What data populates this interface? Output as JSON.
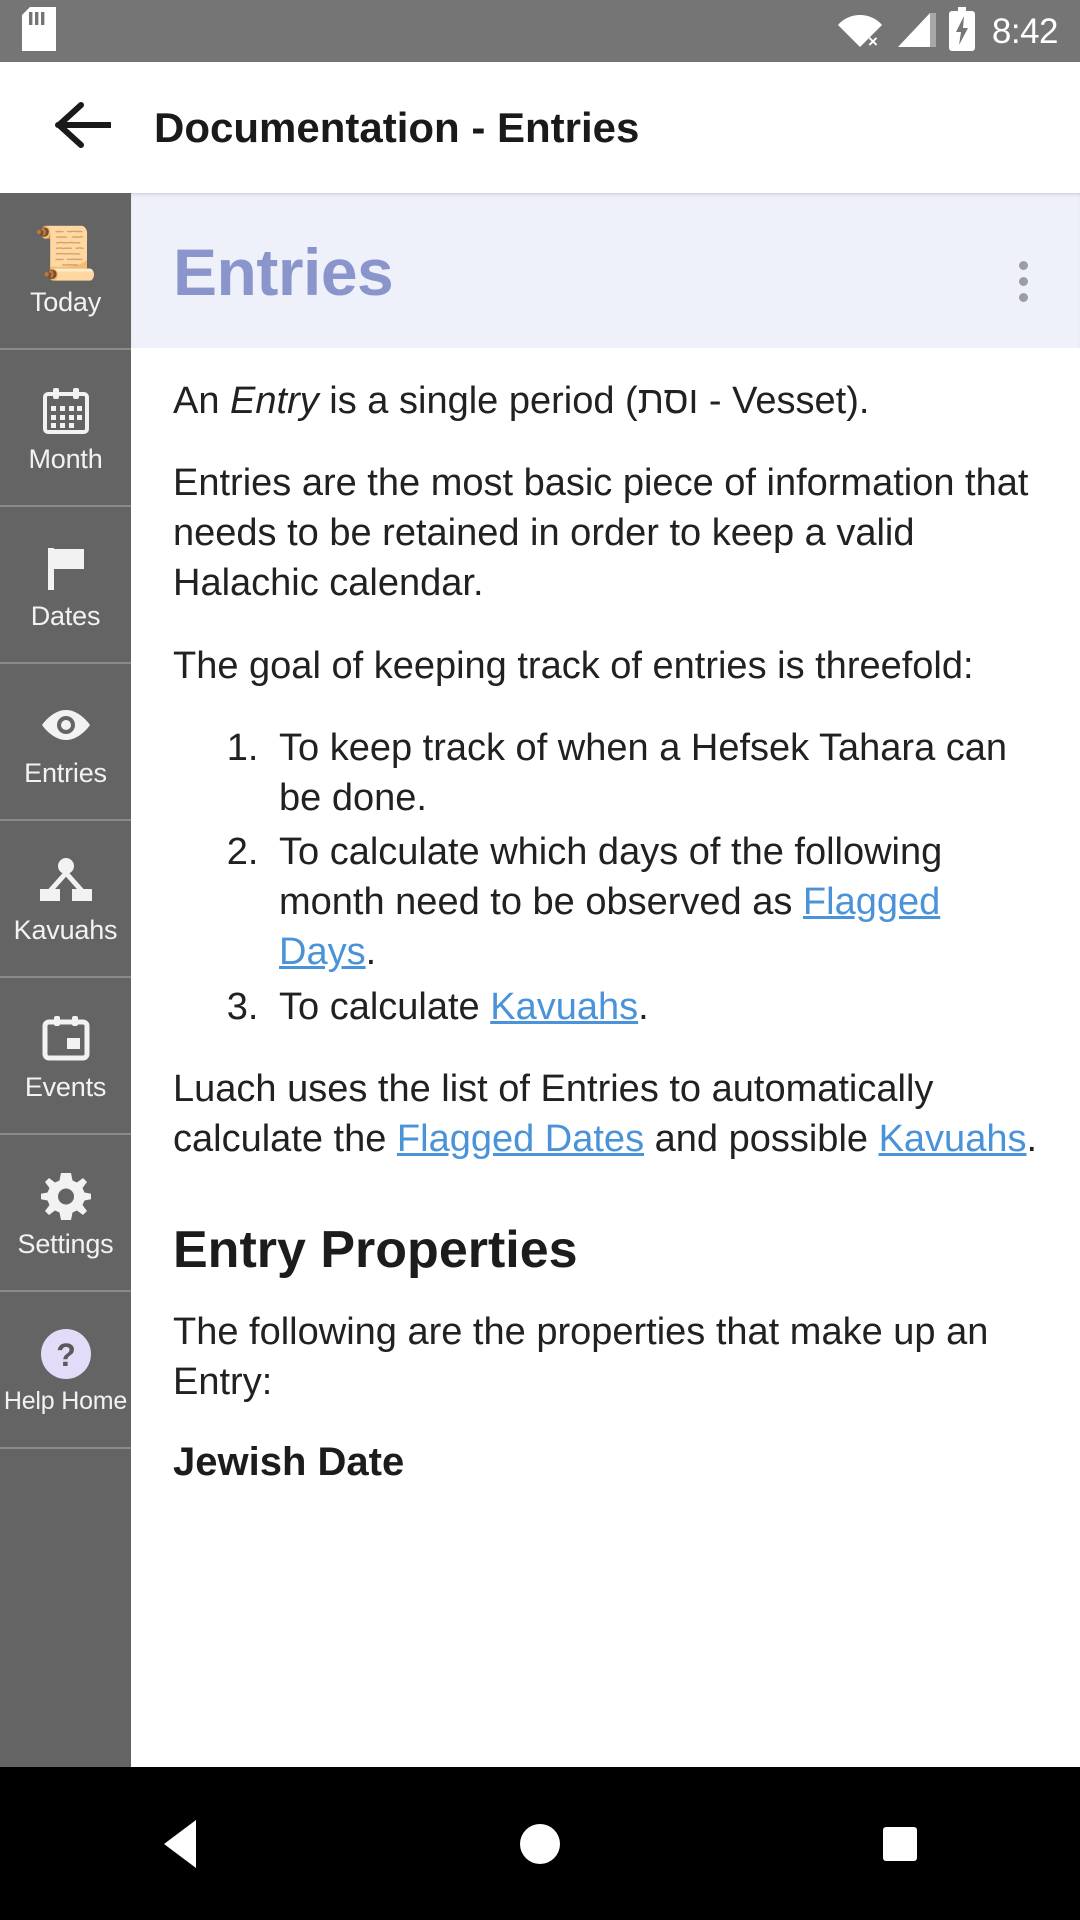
{
  "statusbar": {
    "time": "8:42",
    "icons": [
      "sd-card-icon",
      "wifi-no-internet-icon",
      "cell-signal-icon",
      "battery-charging-icon"
    ]
  },
  "actionbar": {
    "back_icon": "arrow-back-icon",
    "title": "Documentation -  Entries"
  },
  "sidebar": {
    "items": [
      {
        "label": "Today",
        "icon": "scroll-emoji-icon"
      },
      {
        "label": "Month",
        "icon": "calendar-month-icon"
      },
      {
        "label": "Dates",
        "icon": "flag-icon"
      },
      {
        "label": "Entries",
        "icon": "eye-icon"
      },
      {
        "label": "Kavuahs",
        "icon": "account-tree-icon"
      },
      {
        "label": "Events",
        "icon": "event-note-icon"
      },
      {
        "label": "Settings",
        "icon": "gear-icon"
      },
      {
        "label": "Help Home",
        "icon": "help-circle-icon"
      }
    ]
  },
  "doc": {
    "header_title": "Entries",
    "overflow_icon": "more-vertical-icon",
    "p1_prefix": "An ",
    "p1_italic": "Entry",
    "p1_suffix": " is a single period (וסת - Vesset).",
    "p2": "Entries are the most basic piece of information that needs to be retained in order to keep a valid Halachic calendar.",
    "p3": "The goal of keeping track of entries is threefold:",
    "list": [
      {
        "text": "To keep track of when a Hefsek Tahara can be done.",
        "link": "",
        "tail": ""
      },
      {
        "text": "To calculate which days of the following month need to be observed as ",
        "link": "Flagged Days",
        "tail": "."
      },
      {
        "text": "To calculate ",
        "link": "Kavuahs",
        "tail": "."
      }
    ],
    "p4_a": "Luach uses the list of Entries to automatically calculate the ",
    "p4_link1": "Flagged Dates",
    "p4_b": " and possible ",
    "p4_link2": "Kavuahs",
    "p4_c": ".",
    "h2": "Entry Properties",
    "p5": "The following are the properties that make up an Entry:",
    "h3": "Jewish Date"
  },
  "navbar": {
    "back": "nav-back-icon",
    "home": "nav-home-icon",
    "recents": "nav-recents-icon"
  },
  "colors": {
    "status_bar": "#757575",
    "sidebar": "#646464",
    "doc_header_bg": "#eef0fa",
    "doc_title": "#8a95cc",
    "link": "#4a93d9",
    "nav_bar": "#000000"
  }
}
